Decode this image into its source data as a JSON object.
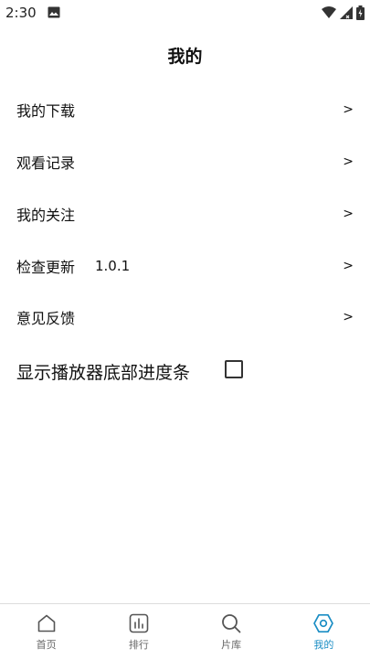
{
  "status_bar": {
    "time": "2:30"
  },
  "page": {
    "title": "我的"
  },
  "menu": [
    {
      "label": "我的下载",
      "value": "",
      "chevron": ">"
    },
    {
      "label": "观看记录",
      "value": "",
      "chevron": ">"
    },
    {
      "label": "我的关注",
      "value": "",
      "chevron": ">"
    },
    {
      "label": "检查更新",
      "value": "1.0.1",
      "chevron": ">"
    },
    {
      "label": "意见反馈",
      "value": "",
      "chevron": ">"
    }
  ],
  "settings": {
    "progress_bar_toggle": {
      "label": "显示播放器底部进度条",
      "checked": false
    }
  },
  "bottom_nav": {
    "items": [
      {
        "label": "首页",
        "icon": "home-icon",
        "active": false
      },
      {
        "label": "排行",
        "icon": "ranking-icon",
        "active": false
      },
      {
        "label": "片库",
        "icon": "search-icon",
        "active": false
      },
      {
        "label": "我的",
        "icon": "profile-hex-icon",
        "active": true
      }
    ]
  },
  "colors": {
    "accent": "#1a8dc4",
    "inactive": "#666666",
    "text": "#111111"
  }
}
